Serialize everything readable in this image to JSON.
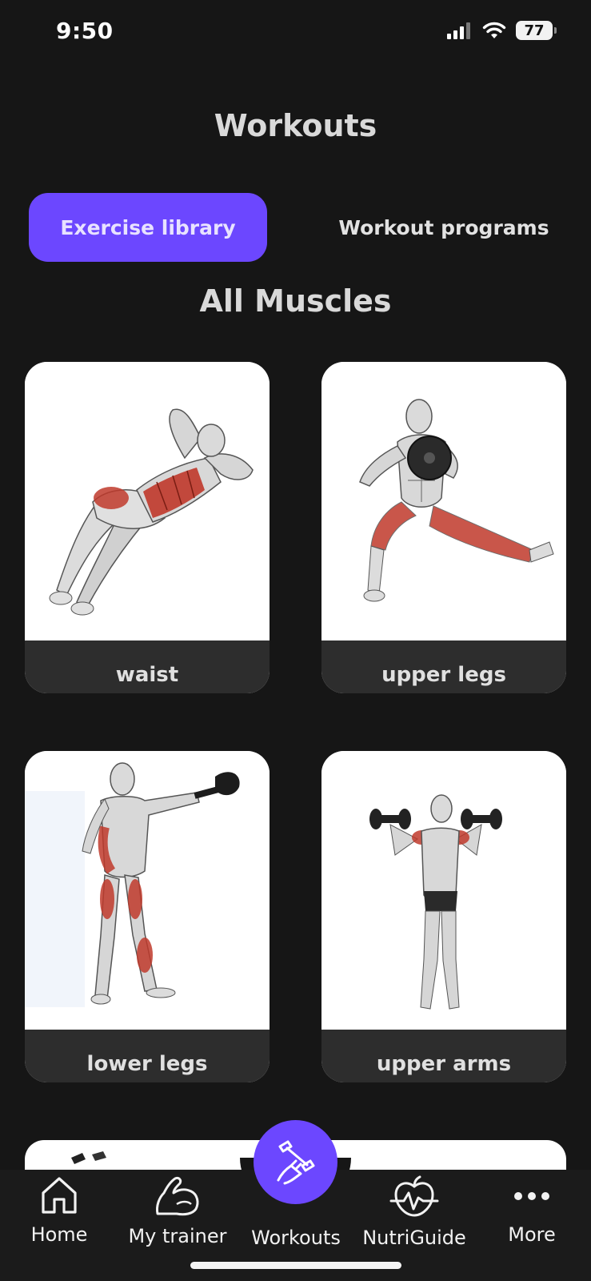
{
  "status": {
    "time": "9:50",
    "battery": "77"
  },
  "header": {
    "title": "Workouts"
  },
  "tabs": {
    "active": "Exercise library",
    "inactive": "Workout programs"
  },
  "section": {
    "title": "All Muscles"
  },
  "cards": [
    {
      "label": "waist"
    },
    {
      "label": "upper legs"
    },
    {
      "label": "lower legs"
    },
    {
      "label": "upper arms"
    }
  ],
  "nav": {
    "home": "Home",
    "trainer": "My trainer",
    "workouts": "Workouts",
    "nutri": "NutriGuide",
    "more": "More"
  },
  "colors": {
    "accent": "#6c47ff",
    "background": "#161616",
    "muscle_highlight": "#c0392b"
  }
}
